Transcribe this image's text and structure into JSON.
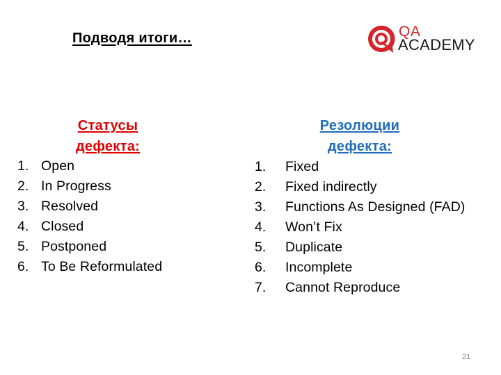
{
  "slide": {
    "title": "Подводя итоги…",
    "page_number": "21"
  },
  "logo": {
    "icon": "qa-academy-logo-icon",
    "line1": "QA",
    "line2": "ACADEMY",
    "colors": {
      "red": "#d3252b",
      "dark": "#1a1a1a"
    }
  },
  "statuses": {
    "heading_line1": "Статусы",
    "heading_line2": "дефекта:",
    "color": "#e00000",
    "items": [
      {
        "num": "1.",
        "label": "Open"
      },
      {
        "num": "2.",
        "label": "In Progress"
      },
      {
        "num": "3.",
        "label": "Resolved"
      },
      {
        "num": "4.",
        "label": "Closed"
      },
      {
        "num": "5.",
        "label": "Postponed"
      },
      {
        "num": "6.",
        "label": "To Be Reformulated"
      }
    ]
  },
  "resolutions": {
    "heading_line1": "Резолюции",
    "heading_line2": "дефекта:",
    "color": "#1f6dbb",
    "items": [
      {
        "num": "1.",
        "label": "Fixed"
      },
      {
        "num": "2.",
        "label": "Fixed indirectly"
      },
      {
        "num": "3.",
        "label": "Functions As Designed (FAD)"
      },
      {
        "num": "4.",
        "label": "Won’t Fix"
      },
      {
        "num": "5.",
        "label": "Duplicate"
      },
      {
        "num": "6.",
        "label": "Incomplete"
      },
      {
        "num": "7.",
        "label": "Cannot Reproduce"
      }
    ]
  }
}
